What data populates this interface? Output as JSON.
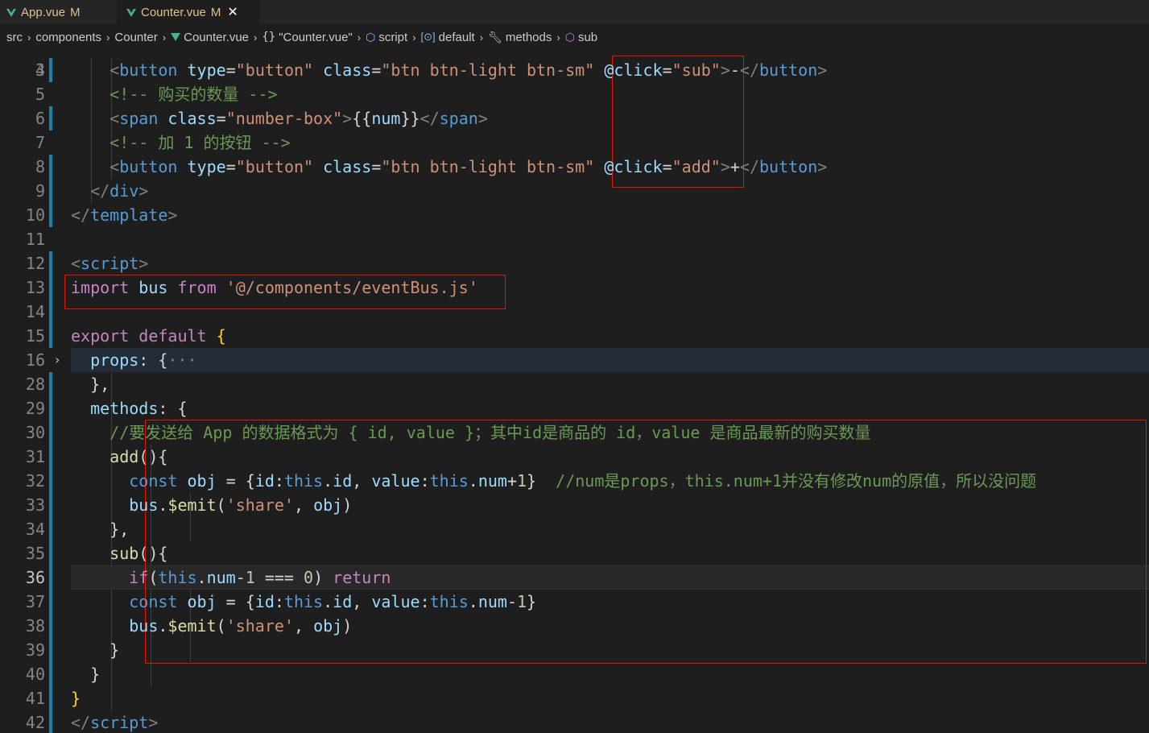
{
  "tabs": [
    {
      "label": "App.vue",
      "status": "M",
      "active": false
    },
    {
      "label": "Counter.vue",
      "status": "M",
      "active": true,
      "close": "✕"
    }
  ],
  "breadcrumb": [
    "src",
    "components",
    "Counter",
    "Counter.vue",
    "\"Counter.vue\"",
    "script",
    "default",
    "methods",
    "sub"
  ],
  "breadcrumb_icons": [
    "vue-icon",
    "braces-icon",
    "cube-icon",
    "namespace-icon",
    "wrench-icon",
    "cube-icon"
  ],
  "editor": {
    "current_line": "36",
    "folded_line": "16",
    "lines": [
      {
        "n": "4",
        "tokens": [
          [
            "t-punc",
            "    <"
          ],
          [
            "t-tag",
            "button"
          ],
          [
            "t-attr",
            " type"
          ],
          [
            "t-white",
            "="
          ],
          [
            "t-str",
            "\"button\""
          ],
          [
            "t-attr",
            " class"
          ],
          [
            "t-white",
            "="
          ],
          [
            "t-str",
            "\"btn btn-light btn-sm\""
          ],
          [
            "t-white",
            " "
          ],
          [
            "t-attr",
            "@click"
          ],
          [
            "t-white",
            "="
          ],
          [
            "t-str",
            "\"sub\""
          ],
          [
            "t-punc",
            ">"
          ],
          [
            "t-white",
            "-"
          ],
          [
            "t-punc",
            "</"
          ],
          [
            "t-tag",
            "button"
          ],
          [
            "t-punc",
            ">"
          ]
        ]
      },
      {
        "n": "5",
        "tokens": [
          [
            "t-cmt",
            "    <!-- 购买的数量 -->"
          ]
        ]
      },
      {
        "n": "6",
        "tokens": [
          [
            "t-punc",
            "    <"
          ],
          [
            "t-tag",
            "span"
          ],
          [
            "t-attr",
            " class"
          ],
          [
            "t-white",
            "="
          ],
          [
            "t-str",
            "\"number-box\""
          ],
          [
            "t-punc",
            ">"
          ],
          [
            "t-white",
            "{{"
          ],
          [
            "t-var",
            "num"
          ],
          [
            "t-white",
            "}}"
          ],
          [
            "t-punc",
            "</"
          ],
          [
            "t-tag",
            "span"
          ],
          [
            "t-punc",
            ">"
          ]
        ]
      },
      {
        "n": "7",
        "tokens": [
          [
            "t-cmt",
            "    <!-- 加 1 的按钮 -->"
          ]
        ]
      },
      {
        "n": "8",
        "tokens": [
          [
            "t-punc",
            "    <"
          ],
          [
            "t-tag",
            "button"
          ],
          [
            "t-attr",
            " type"
          ],
          [
            "t-white",
            "="
          ],
          [
            "t-str",
            "\"button\""
          ],
          [
            "t-attr",
            " class"
          ],
          [
            "t-white",
            "="
          ],
          [
            "t-str",
            "\"btn btn-light btn-sm\""
          ],
          [
            "t-white",
            " "
          ],
          [
            "t-attr",
            "@click"
          ],
          [
            "t-white",
            "="
          ],
          [
            "t-str",
            "\"add\""
          ],
          [
            "t-punc",
            ">"
          ],
          [
            "t-white",
            "+"
          ],
          [
            "t-punc",
            "</"
          ],
          [
            "t-tag",
            "button"
          ],
          [
            "t-punc",
            ">"
          ]
        ]
      },
      {
        "n": "9",
        "tokens": [
          [
            "t-punc",
            "  </"
          ],
          [
            "t-tag",
            "div"
          ],
          [
            "t-punc",
            ">"
          ]
        ]
      },
      {
        "n": "10",
        "tokens": [
          [
            "t-punc",
            "</"
          ],
          [
            "t-tag",
            "template"
          ],
          [
            "t-punc",
            ">"
          ]
        ]
      },
      {
        "n": "11",
        "tokens": []
      },
      {
        "n": "12",
        "tokens": [
          [
            "t-punc",
            "<"
          ],
          [
            "t-tag",
            "script"
          ],
          [
            "t-punc",
            ">"
          ]
        ]
      },
      {
        "n": "13",
        "tokens": [
          [
            "t-kw",
            "import"
          ],
          [
            "t-var",
            " bus"
          ],
          [
            "t-kw",
            " from"
          ],
          [
            "t-str",
            " '@/components/eventBus.js'"
          ]
        ]
      },
      {
        "n": "14",
        "tokens": []
      },
      {
        "n": "15",
        "tokens": [
          [
            "t-kw",
            "export"
          ],
          [
            "t-kw",
            " default"
          ],
          [
            "t-white",
            " "
          ],
          [
            "t-brace",
            "{"
          ]
        ]
      },
      {
        "n": "16",
        "tokens": [
          [
            "t-var",
            "  props"
          ],
          [
            "t-white",
            ": {"
          ],
          [
            "t-punc",
            "···"
          ]
        ]
      },
      {
        "n": "28",
        "tokens": [
          [
            "t-white",
            "  },"
          ]
        ]
      },
      {
        "n": "29",
        "tokens": [
          [
            "t-var",
            "  methods"
          ],
          [
            "t-white",
            ": {"
          ]
        ]
      },
      {
        "n": "30",
        "tokens": [
          [
            "t-cmt",
            "    //要发送给 App 的数据格式为 { id, value }；其中id是商品的 id，value 是商品最新的购买数量"
          ]
        ]
      },
      {
        "n": "31",
        "tokens": [
          [
            "t-fn",
            "    add"
          ],
          [
            "t-white",
            "(){"
          ]
        ]
      },
      {
        "n": "32",
        "tokens": [
          [
            "t-blue",
            "      const"
          ],
          [
            "t-var",
            " obj"
          ],
          [
            "t-white",
            " = {"
          ],
          [
            "t-var",
            "id"
          ],
          [
            "t-white",
            ":"
          ],
          [
            "t-blue",
            "this"
          ],
          [
            "t-white",
            "."
          ],
          [
            "t-var",
            "id"
          ],
          [
            "t-white",
            ", "
          ],
          [
            "t-var",
            "value"
          ],
          [
            "t-white",
            ":"
          ],
          [
            "t-blue",
            "this"
          ],
          [
            "t-white",
            "."
          ],
          [
            "t-var",
            "num"
          ],
          [
            "t-white",
            "+"
          ],
          [
            "t-num",
            "1"
          ],
          [
            "t-white",
            "}  "
          ],
          [
            "t-cmt",
            "//num是props，this.num+1并没有修改num的原值，所以没问题"
          ]
        ]
      },
      {
        "n": "33",
        "tokens": [
          [
            "t-var",
            "      bus"
          ],
          [
            "t-white",
            "."
          ],
          [
            "t-fn",
            "$emit"
          ],
          [
            "t-white",
            "("
          ],
          [
            "t-str",
            "'share'"
          ],
          [
            "t-white",
            ", "
          ],
          [
            "t-var",
            "obj"
          ],
          [
            "t-white",
            ")"
          ]
        ]
      },
      {
        "n": "34",
        "tokens": [
          [
            "t-white",
            "    },"
          ]
        ]
      },
      {
        "n": "35",
        "tokens": [
          [
            "t-fn",
            "    sub"
          ],
          [
            "t-white",
            "(){"
          ]
        ]
      },
      {
        "n": "36",
        "tokens": [
          [
            "t-kw",
            "      if"
          ],
          [
            "t-white",
            "("
          ],
          [
            "t-blue",
            "this"
          ],
          [
            "t-white",
            "."
          ],
          [
            "t-var",
            "num"
          ],
          [
            "t-white",
            "-"
          ],
          [
            "t-num",
            "1"
          ],
          [
            "t-white",
            " === "
          ],
          [
            "t-num",
            "0"
          ],
          [
            "t-white",
            ") "
          ],
          [
            "t-kw",
            "return"
          ]
        ]
      },
      {
        "n": "37",
        "tokens": [
          [
            "t-blue",
            "      const"
          ],
          [
            "t-var",
            " obj"
          ],
          [
            "t-white",
            " = {"
          ],
          [
            "t-var",
            "id"
          ],
          [
            "t-white",
            ":"
          ],
          [
            "t-blue",
            "this"
          ],
          [
            "t-white",
            "."
          ],
          [
            "t-var",
            "id"
          ],
          [
            "t-white",
            ", "
          ],
          [
            "t-var",
            "value"
          ],
          [
            "t-white",
            ":"
          ],
          [
            "t-blue",
            "this"
          ],
          [
            "t-white",
            "."
          ],
          [
            "t-var",
            "num"
          ],
          [
            "t-white",
            "-"
          ],
          [
            "t-num",
            "1"
          ],
          [
            "t-white",
            "}"
          ]
        ]
      },
      {
        "n": "38",
        "tokens": [
          [
            "t-var",
            "      bus"
          ],
          [
            "t-white",
            "."
          ],
          [
            "t-fn",
            "$emit"
          ],
          [
            "t-white",
            "("
          ],
          [
            "t-str",
            "'share'"
          ],
          [
            "t-white",
            ", "
          ],
          [
            "t-var",
            "obj"
          ],
          [
            "t-white",
            ")"
          ]
        ]
      },
      {
        "n": "39",
        "tokens": [
          [
            "t-white",
            "    }"
          ]
        ]
      },
      {
        "n": "40",
        "tokens": [
          [
            "t-white",
            "  }"
          ]
        ]
      },
      {
        "n": "41",
        "tokens": [
          [
            "t-brace",
            "}"
          ]
        ]
      },
      {
        "n": "42",
        "tokens": [
          [
            "t-punc",
            "</"
          ],
          [
            "t-tag",
            "script"
          ],
          [
            "t-punc",
            ">"
          ]
        ]
      }
    ]
  }
}
